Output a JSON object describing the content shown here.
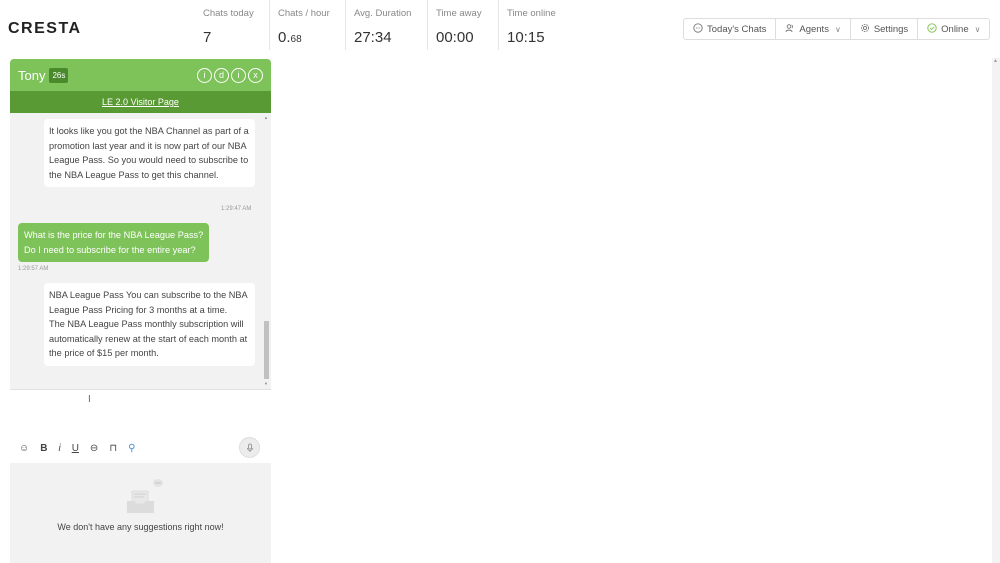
{
  "app": {
    "logo": "CRESTA"
  },
  "stats": [
    {
      "label": "Chats today",
      "value": "7"
    },
    {
      "label": "Chats / hour",
      "value_main": "0.",
      "value_small": "68"
    },
    {
      "label": "Avg. Duration",
      "value": "27:34"
    },
    {
      "label": "Time away",
      "value": "00:00"
    },
    {
      "label": "Time online",
      "value": "10:15"
    }
  ],
  "toolbar": {
    "todays_chats": {
      "label": "Today's Chats",
      "icon": "chat-bubble-icon"
    },
    "agents": {
      "label": "Agents",
      "icon": "agents-icon"
    },
    "settings": {
      "label": "Settings",
      "icon": "gear-icon"
    },
    "status": {
      "label": "Online",
      "icon": "check-circle-icon",
      "color": "#7cc04b"
    }
  },
  "chat": {
    "visitor_name": "Tony",
    "timer": "26s",
    "header_icons": [
      "i",
      "d",
      "i",
      "x"
    ],
    "page_link": "LE 2.0 Visitor Page",
    "messages": [
      {
        "from": "agent",
        "text": "It looks like you got the NBA Channel as part of a promotion last year and it is now part of our NBA League Pass. So you would need to subscribe to the NBA League Pass to get this channel.",
        "time": "1:29:47 AM"
      },
      {
        "from": "visitor",
        "lines": [
          "What is the price for the NBA League Pass?",
          "Do I need to subscribe for the entire year?"
        ],
        "time": "1:29:57 AM"
      },
      {
        "from": "agent",
        "lines": [
          "NBA League Pass You can subscribe to the NBA League Pass Pricing for 3 months at a time.",
          "The NBA League Pass monthly subscription will automatically renew at the start of each month at the price of $15 per month."
        ]
      }
    ],
    "composer": {
      "value": "",
      "tools": {
        "emoji": "☺",
        "bold": "B",
        "italic": "i",
        "underline": "U",
        "link": "⊖",
        "book": "⊓",
        "search": "⚲"
      }
    },
    "suggestions_empty": "We don't have any suggestions right now!"
  },
  "colors": {
    "header_green": "#7ec25a",
    "subheader_green": "#5a9a34",
    "timer_badge": "#4a8a2c"
  }
}
